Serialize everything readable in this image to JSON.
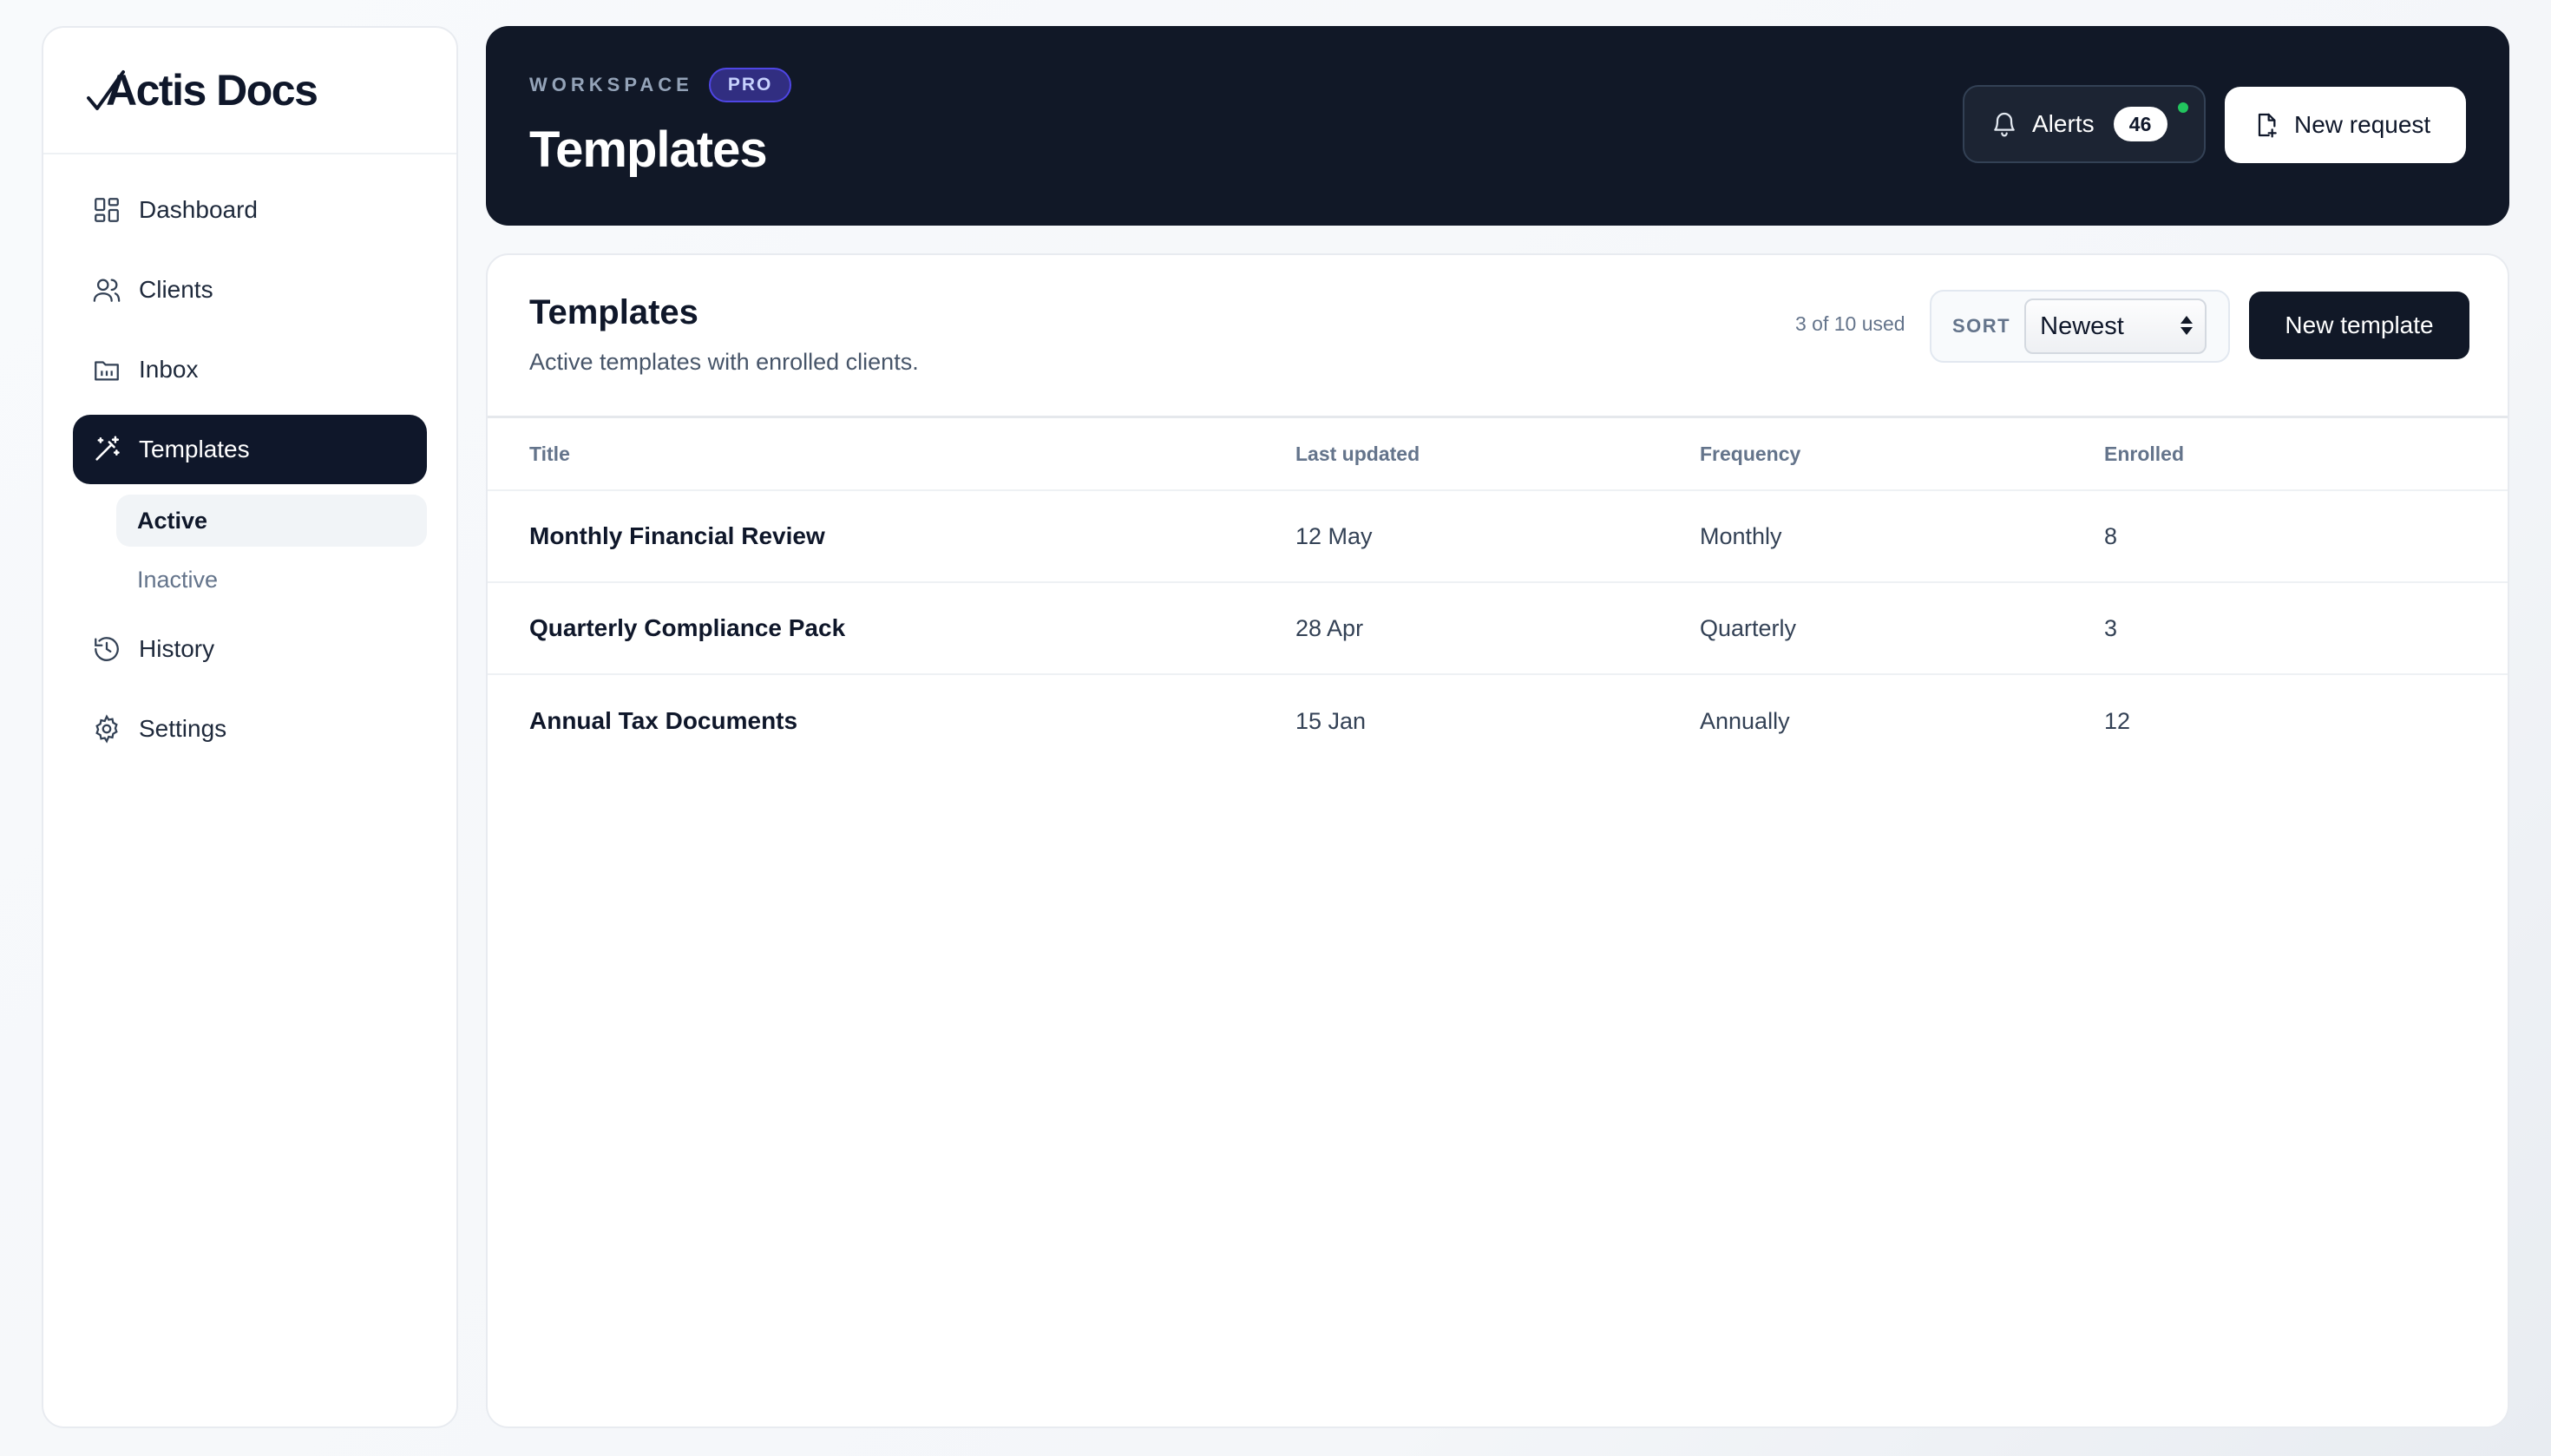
{
  "brand": {
    "name": "Actis Docs"
  },
  "sidebar": {
    "items": [
      {
        "label": "Dashboard",
        "icon": "dashboard-icon"
      },
      {
        "label": "Clients",
        "icon": "users-icon"
      },
      {
        "label": "Inbox",
        "icon": "inbox-icon"
      },
      {
        "label": "Templates",
        "icon": "magic-wand-icon",
        "active": true
      },
      {
        "label": "History",
        "icon": "history-icon"
      },
      {
        "label": "Settings",
        "icon": "gear-icon"
      }
    ],
    "templates_sub": [
      {
        "label": "Active",
        "active": true
      },
      {
        "label": "Inactive"
      }
    ]
  },
  "header": {
    "eyebrow": "WORKSPACE",
    "badge": "PRO",
    "title": "Templates",
    "alerts_label": "Alerts",
    "alerts_count": "46",
    "new_request_label": "New request"
  },
  "card": {
    "title": "Templates",
    "subtitle": "Active templates with enrolled clients.",
    "usage": "3 of 10 used",
    "sort_label": "SORT",
    "sort_value": "Newest",
    "new_template_label": "New template"
  },
  "table": {
    "columns": [
      "Title",
      "Last updated",
      "Frequency",
      "Enrolled"
    ],
    "rows": [
      {
        "title": "Monthly Financial Review",
        "updated": "12 May",
        "frequency": "Monthly",
        "enrolled": "8"
      },
      {
        "title": "Quarterly Compliance Pack",
        "updated": "28 Apr",
        "frequency": "Quarterly",
        "enrolled": "3"
      },
      {
        "title": "Annual Tax Documents",
        "updated": "15 Jan",
        "frequency": "Annually",
        "enrolled": "12"
      }
    ]
  },
  "colors": {
    "primary_dark": "#111827",
    "accent_badge": "#312e81",
    "status_dot": "#22c55e"
  }
}
